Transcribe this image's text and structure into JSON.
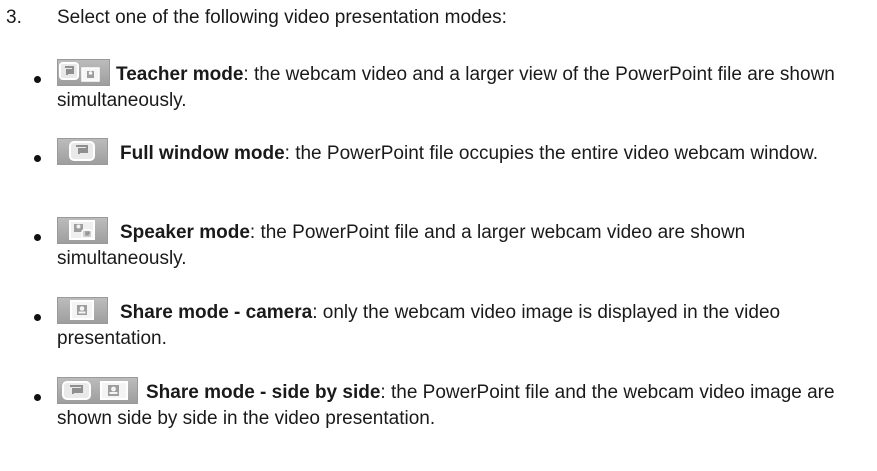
{
  "step": {
    "number": "3.",
    "text": "Select one of the following video presentation modes:"
  },
  "modes": [
    {
      "icon": "teacher-mode-icon",
      "title": "Teacher mode",
      "description": ": the webcam video and a larger view of the PowerPoint file are shown simultaneously."
    },
    {
      "icon": "full-window-mode-icon",
      "title": "Full window mode",
      "description": ": the PowerPoint file occupies the entire video webcam window."
    },
    {
      "icon": "speaker-mode-icon",
      "title": "Speaker mode",
      "description": ": the PowerPoint file and a larger webcam video are shown simultaneously."
    },
    {
      "icon": "share-mode-camera-icon",
      "title": "Share mode - camera",
      "description": ": only the webcam video image is displayed in the video presentation."
    },
    {
      "icon": "share-mode-side-by-side-icon",
      "title": "Share mode - side by side",
      "description": ": the PowerPoint file and the webcam video image are shown side by side in the video presentation."
    }
  ]
}
